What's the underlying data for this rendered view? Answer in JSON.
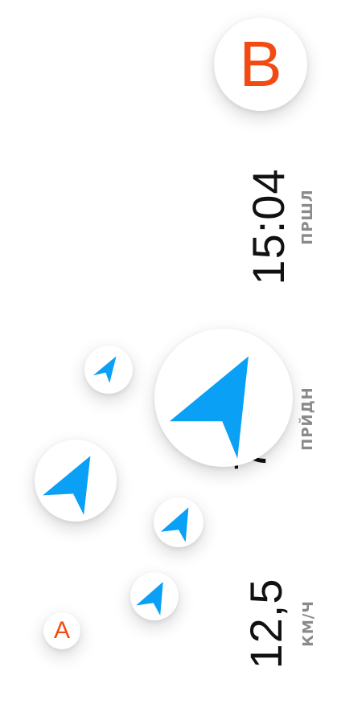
{
  "colors": {
    "accent_orange": "#f24a12",
    "arrow_blue": "#0aa0f5",
    "text": "#111111",
    "unit_gray": "#8a8a8a"
  },
  "pins": {
    "destination_label": "B",
    "origin_label": "A"
  },
  "stats": {
    "arrival": {
      "value": "15:04",
      "unit": "ПРШЛ"
    },
    "remaining": {
      "value": "7",
      "unit": "ПРЙДН"
    },
    "speed": {
      "value": "12,5",
      "unit": "КМ/Ч"
    }
  },
  "icons": {
    "position": "navigation-arrow-icon",
    "destination": "destination-pin-icon",
    "origin": "origin-pin-icon"
  }
}
